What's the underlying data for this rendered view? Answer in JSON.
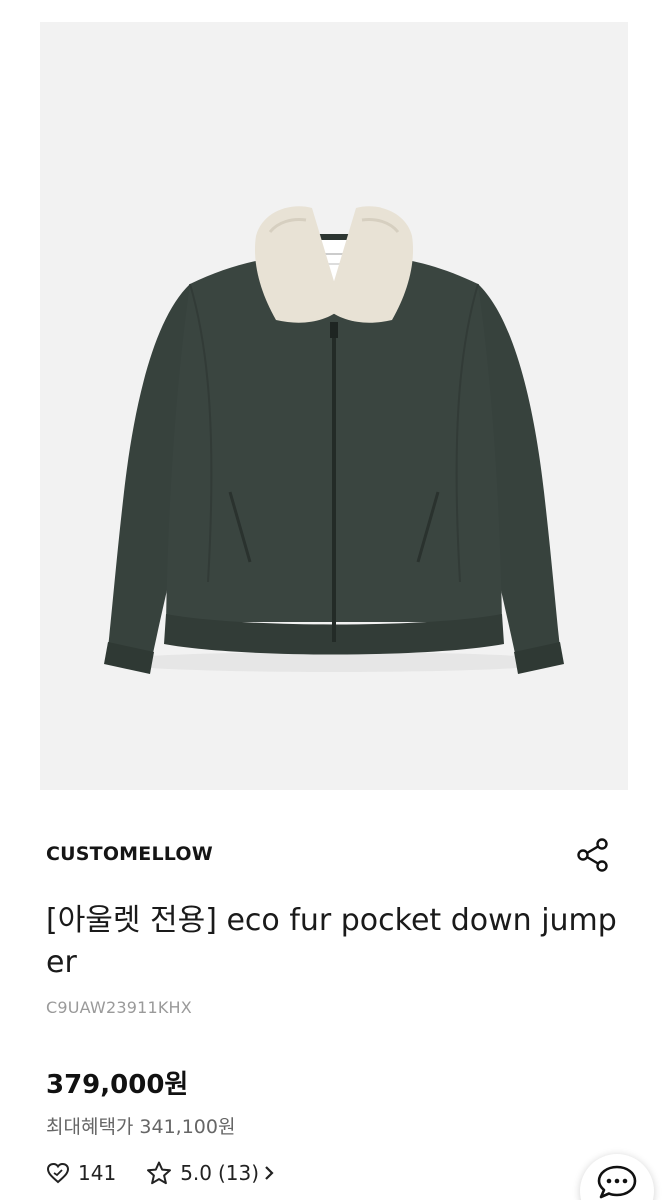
{
  "product": {
    "brand": "CUSTOMELLOW",
    "title": "[아울렛 전용] eco fur pocket down jumper",
    "sku": "C9UAW23911KHX",
    "price": "379,000원",
    "benefit_label": "최대혜택가",
    "benefit_price": "341,100원",
    "like_count": "141",
    "rating": "5.0",
    "review_count": "(13)"
  },
  "icons": {
    "share": "share-icon",
    "like": "heart-icon",
    "rating": "star-icon",
    "more": "chevron-right-icon",
    "chat": "chat-bubble-icon"
  },
  "colors": {
    "jacket": "#3a4540",
    "collar": "#e8e2d5",
    "image_background": "#f2f2f2"
  }
}
